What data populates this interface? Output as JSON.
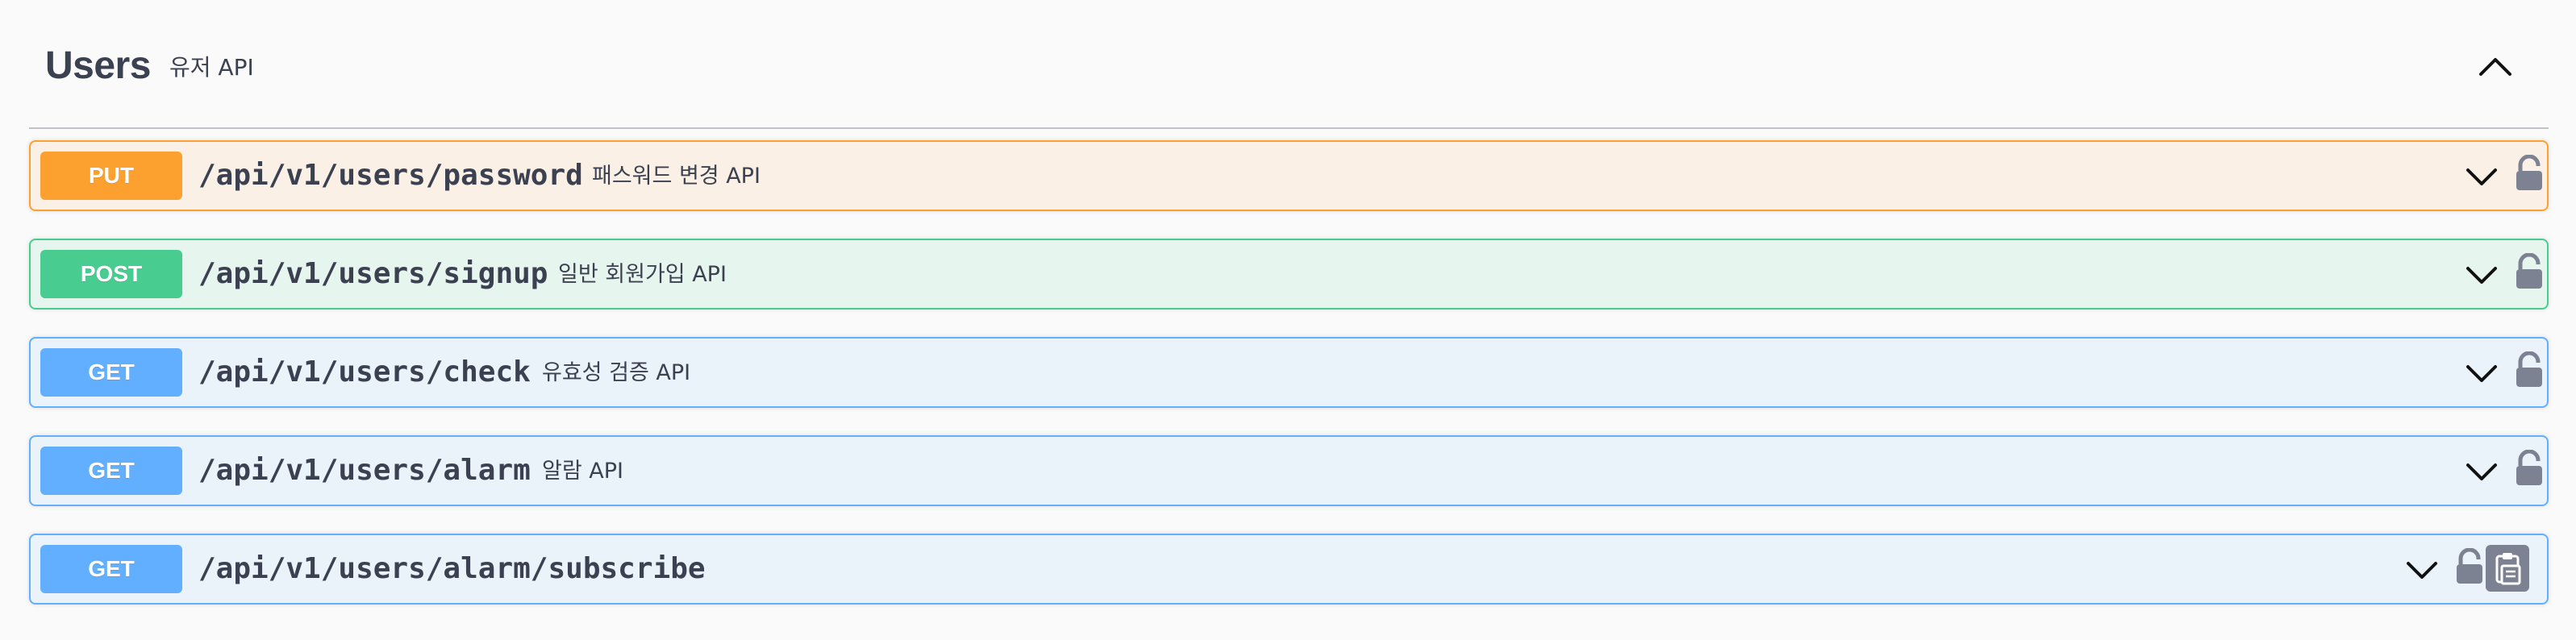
{
  "tag": {
    "name": "Users",
    "description": "유저 API"
  },
  "operations": [
    {
      "method": "PUT",
      "path": "/api/v1/users/password",
      "summary": "패스워드 변경 API"
    },
    {
      "method": "POST",
      "path": "/api/v1/users/signup",
      "summary": "일반 회원가입 API"
    },
    {
      "method": "GET",
      "path": "/api/v1/users/check",
      "summary": "유효성 검증 API"
    },
    {
      "method": "GET",
      "path": "/api/v1/users/alarm",
      "summary": "알람 API"
    },
    {
      "method": "GET",
      "path": "/api/v1/users/alarm/subscribe",
      "summary": ""
    }
  ],
  "colors": {
    "put": "#fca130",
    "post": "#49cc90",
    "get": "#61affe",
    "text": "#3b4151",
    "lock": "#7d8293"
  },
  "icons": [
    "chevron-up-icon",
    "chevron-down-icon",
    "lock-icon",
    "copy-to-clipboard-icon"
  ]
}
